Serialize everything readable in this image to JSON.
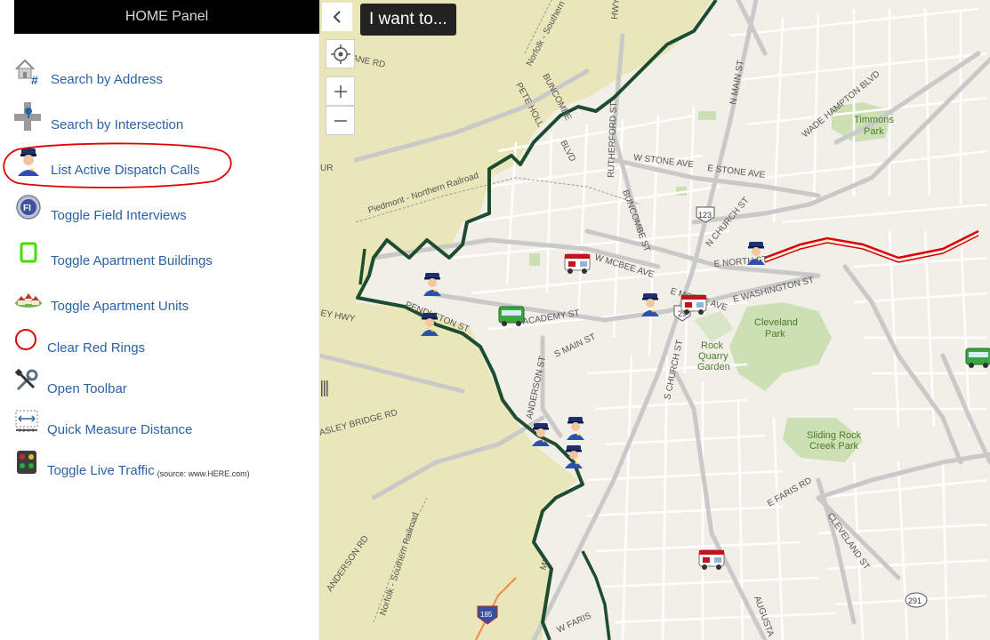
{
  "panel": {
    "title": "HOME Panel",
    "items": [
      {
        "label": "Search by Address",
        "icon": "house-address-icon"
      },
      {
        "label": "Search by Intersection",
        "icon": "intersection-icon"
      },
      {
        "label": "List Active Dispatch Calls",
        "icon": "police-officer-icon"
      },
      {
        "label": "Toggle Field Interviews",
        "icon": "fi-badge-icon"
      },
      {
        "label": "Toggle Apartment Buildings",
        "icon": "green-square-icon"
      },
      {
        "label": "Toggle Apartment Units",
        "icon": "apartment-units-icon"
      },
      {
        "label": "Clear Red Rings",
        "icon": "red-ring-icon"
      },
      {
        "label": "Open Toolbar",
        "icon": "tools-icon"
      },
      {
        "label": "Quick Measure Distance",
        "icon": "measure-icon"
      },
      {
        "label": "Toggle Live Traffic",
        "icon": "traffic-light-icon",
        "note": "(source: www.HERE.com)"
      }
    ]
  },
  "toolbar": {
    "i_want_to": "I want to..."
  },
  "map": {
    "streets": {
      "s1": "W STONE AVE",
      "s2": "E STONE AVE",
      "s3": "W MCBEE AVE",
      "s4": "E MCBEE AVE",
      "s5": "E NORTH ST",
      "s6": "E WASHINGTON ST",
      "s7": "ACADEMY ST",
      "s8": "S MAIN ST",
      "s9": "PENDLETON ST",
      "s10": "ANDERSON ST",
      "s11": "S CHURCH ST",
      "s12": "N CHURCH ST",
      "s13": "BUNCOMBE ST",
      "s14": "RUTHERFORD ST",
      "s15": "WADE HAMPTON BLVD",
      "s16": "N MAIN ST",
      "s17": "E FARIS RD",
      "s18": "CLEVELAND ST",
      "s19": "AUGUSTA",
      "s20": "W FARIS",
      "s21": "ANDERSON RD",
      "s22": "ASLEY BRIDGE RD",
      "s23": "EY HWY",
      "s24": "LANE RD",
      "s25": "PETE HOLL",
      "s26": "BLVD",
      "s27": "BUNCOMBE",
      "s28": "Norfolk - Southern R",
      "s29": "Piedmont - Northern Railroad",
      "s30": "Norfolk - Southern Railroad",
      "s31": "MI",
      "s32": "UR",
      "s33": "HWY",
      "s34": "Norfolk - Southern Railroad"
    },
    "places": {
      "timmons1": "Timmons",
      "timmons2": "Park",
      "cleveland1": "Cleveland",
      "cleveland2": "Park",
      "rock1": "Rock",
      "rock2": "Quarry",
      "rock3": "Garden",
      "sliding1": "Sliding Rock",
      "sliding2": "Creek Park"
    },
    "shields": {
      "us123": "123",
      "us29": "29",
      "i185": "185",
      "r291": "291"
    }
  },
  "colors": {
    "boundary": "#1d4d2e",
    "traffic": "#dd0000",
    "annotation": "#e00000",
    "link": "#2a62a8"
  }
}
